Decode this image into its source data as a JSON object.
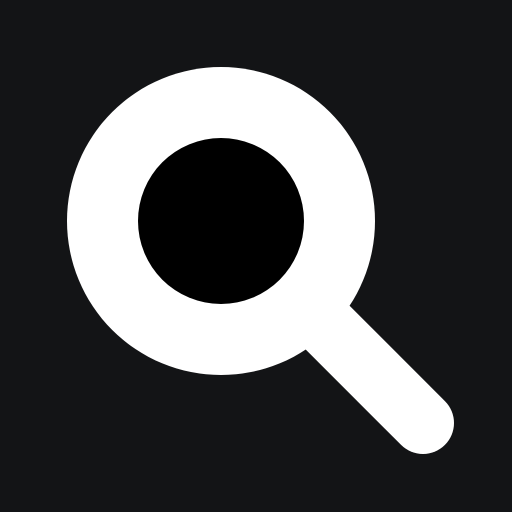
{
  "app": {
    "icon": "search-icon"
  },
  "colors": {
    "background": "#131416",
    "ring": "#ffffff",
    "lens": "#000000",
    "handle": "#ffffff"
  }
}
